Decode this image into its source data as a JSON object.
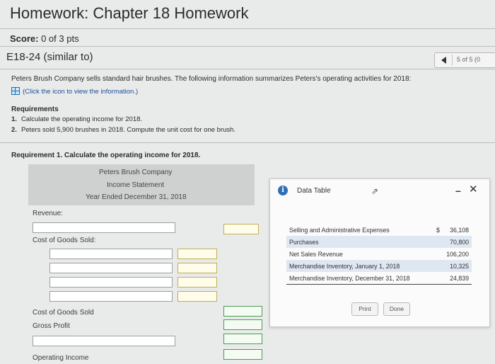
{
  "header": {
    "title": "Homework: Chapter 18 Homework",
    "score_label": "Score:",
    "score_value": "0 of 3 pts"
  },
  "problem": {
    "id": "E18-24 (similar to)",
    "nav_count": "5 of 5 (0"
  },
  "intro": "Peters Brush Company sells standard hair brushes. The following information summarizes Peters's operating activities for 2018:",
  "click_info": "(Click the icon to view the information.)",
  "requirements": {
    "heading": "Requirements",
    "items": [
      {
        "num": "1.",
        "text": "Calculate the operating income for 2018."
      },
      {
        "num": "2.",
        "text": "Peters sold 5,900 brushes in 2018. Compute the unit cost for one brush."
      }
    ]
  },
  "req1_heading": "Requirement 1. Calculate the operating income for 2018.",
  "statement": {
    "company": "Peters Brush Company",
    "name": "Income Statement",
    "period": "Year Ended December 31, 2018",
    "labels": {
      "revenue": "Revenue:",
      "cogs": "Cost of Goods Sold:",
      "cogs_total": "Cost of Goods Sold",
      "gross_profit": "Gross Profit",
      "operating_income": "Operating Income"
    }
  },
  "modal": {
    "title": "Data Table",
    "info_icon": "i",
    "rows": [
      {
        "label": "Selling and Administrative Expenses",
        "currency": "$",
        "value": "36,108"
      },
      {
        "label": "Purchases",
        "currency": "",
        "value": "70,800"
      },
      {
        "label": "Net Sales Revenue",
        "currency": "",
        "value": "106,200"
      },
      {
        "label": "Merchandise Inventory, January 1, 2018",
        "currency": "",
        "value": "10,325"
      },
      {
        "label": "Merchandise Inventory, December 31, 2018",
        "currency": "",
        "value": "24,839"
      }
    ],
    "print_label": "Print",
    "done_label": "Done"
  },
  "icons": {
    "prev": "chevron-left-icon",
    "data_table": "data-table-icon",
    "info": "info-icon",
    "minimize": "minimize-icon",
    "close": "close-icon"
  }
}
